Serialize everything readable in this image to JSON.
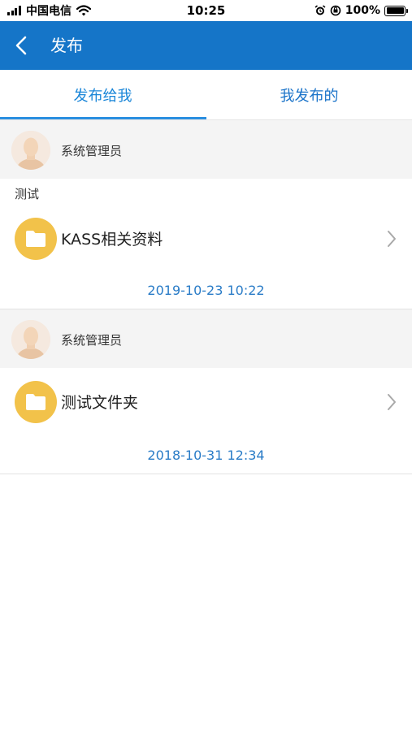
{
  "status_bar": {
    "carrier": "中国电信",
    "time": "10:25",
    "battery": "100%"
  },
  "nav": {
    "title": "发布"
  },
  "tabs": [
    {
      "label": "发布给我",
      "active": true
    },
    {
      "label": "我发布的",
      "active": false
    }
  ],
  "items": [
    {
      "sender": "系统管理员",
      "note": "测试",
      "file_name": "KASS相关资料",
      "date": "2019-10-23 10:22"
    },
    {
      "sender": "系统管理员",
      "note": "",
      "file_name": "测试文件夹",
      "date": "2018-10-31 12:34"
    }
  ],
  "colors": {
    "nav_bg": "#1575c8",
    "tab_active": "#1a86d8",
    "folder": "#f2c24a",
    "date_text": "#2a7cc7"
  },
  "icons": {
    "back": "chevron-left-icon",
    "folder": "folder-icon",
    "row_arrow": "chevron-right-icon",
    "avatar": "user-avatar-icon"
  }
}
